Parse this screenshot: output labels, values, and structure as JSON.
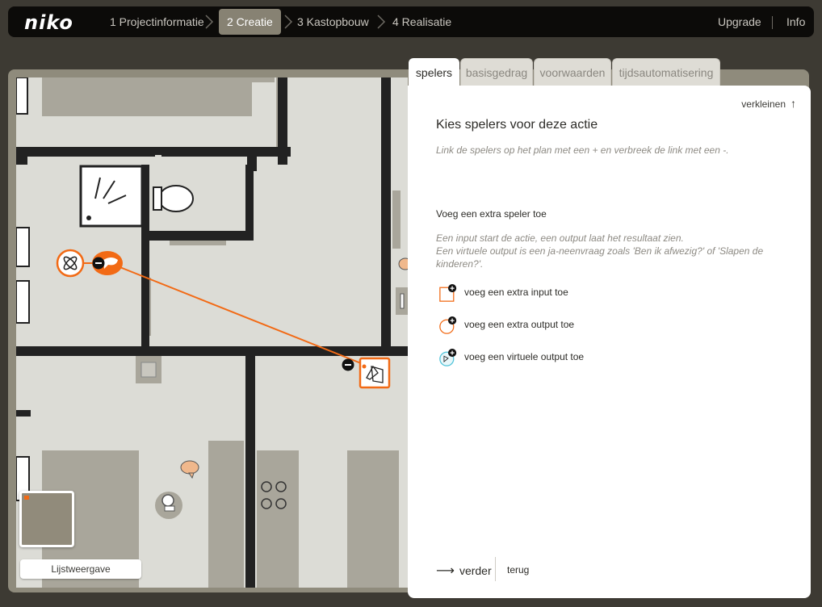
{
  "app": {
    "logo": "niko"
  },
  "steps": [
    {
      "label": "1 Projectinformatie",
      "active": false
    },
    {
      "label": "2 Creatie",
      "active": true
    },
    {
      "label": "3 Kastopbouw",
      "active": false
    },
    {
      "label": "4 Realisatie",
      "active": false
    }
  ],
  "toplinks": {
    "upgrade": "Upgrade",
    "info": "Info"
  },
  "tabs": [
    {
      "label": "spelers",
      "active": true
    },
    {
      "label": "basisgedrag",
      "active": false
    },
    {
      "label": "voorwaarden",
      "active": false
    },
    {
      "label": "tijdsautomatisering",
      "active": false
    }
  ],
  "panel": {
    "shrink_label": "verkleinen",
    "title": "Kies spelers voor deze actie",
    "hint": "Link de spelers op het plan met een + en verbreek de link met een -.",
    "subtitle": "Voeg een extra speler toe",
    "description_line1": "Een input start de actie, een output laat het resultaat zien.",
    "description_line2": "Een virtuele output is een ja-neenvraag zoals 'Ben ik afwezig?' of 'Slapen de kinderen?'.",
    "add_input": "voeg een extra input toe",
    "add_output": "voeg een extra output toe",
    "add_virtual": "voeg een virtuele output toe",
    "next": "verder",
    "back": "terug"
  },
  "map": {
    "list_view": "Lijstweergave"
  },
  "colors": {
    "accent": "#f26a15",
    "walls": "#222222",
    "floor": "#dcdcd6",
    "furniture": "#a9a69b",
    "virtual": "#4fc3d9"
  }
}
